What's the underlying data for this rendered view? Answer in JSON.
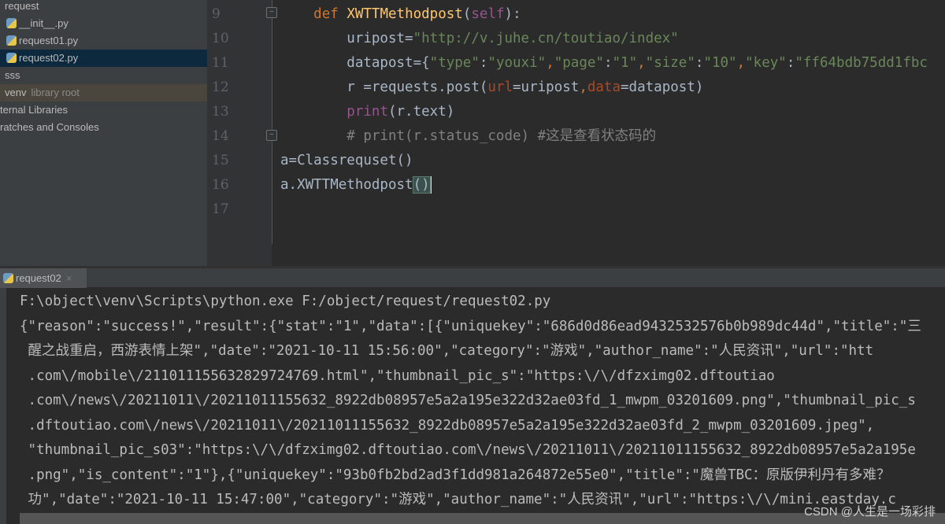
{
  "sidebar": {
    "items": [
      {
        "label": "request",
        "kind": "folder"
      },
      {
        "label": "__init__.py",
        "kind": "python-file"
      },
      {
        "label": "request01.py",
        "kind": "python-file"
      },
      {
        "label": "request02.py",
        "kind": "python-file",
        "selected": true
      },
      {
        "label": "sss",
        "kind": "folder"
      },
      {
        "label": "venv",
        "kind": "folder",
        "suffix": "library root"
      },
      {
        "label": "ternal Libraries",
        "kind": "node"
      },
      {
        "label": "ratches and Consoles",
        "kind": "node"
      }
    ]
  },
  "editor": {
    "line_numbers": [
      "9",
      "10",
      "11",
      "12",
      "13",
      "14",
      "15",
      "16",
      "17"
    ],
    "lines": [
      [
        {
          "t": "    ",
          "c": "pl"
        },
        {
          "t": "def ",
          "c": "kw"
        },
        {
          "t": "XWTTMethodpost",
          "c": "fn"
        },
        {
          "t": "(",
          "c": "pl"
        },
        {
          "t": "self",
          "c": "sf"
        },
        {
          "t": "):",
          "c": "pl"
        }
      ],
      [
        {
          "t": "        uripost=",
          "c": "pl"
        },
        {
          "t": "\"http://v.juhe.cn/toutiao/index\"",
          "c": "st"
        }
      ],
      [
        {
          "t": "        datapost={",
          "c": "pl"
        },
        {
          "t": "\"type\"",
          "c": "st"
        },
        {
          "t": ":",
          "c": "pl"
        },
        {
          "t": "\"youxi\"",
          "c": "st"
        },
        {
          "t": ",",
          "c": "kw"
        },
        {
          "t": "\"page\"",
          "c": "st"
        },
        {
          "t": ":",
          "c": "pl"
        },
        {
          "t": "\"1\"",
          "c": "st"
        },
        {
          "t": ",",
          "c": "kw"
        },
        {
          "t": "\"size\"",
          "c": "st"
        },
        {
          "t": ":",
          "c": "pl"
        },
        {
          "t": "\"10\"",
          "c": "st"
        },
        {
          "t": ",",
          "c": "kw"
        },
        {
          "t": "\"key\"",
          "c": "st"
        },
        {
          "t": ":",
          "c": "pl"
        },
        {
          "t": "\"ff64bdb75dd1fbc",
          "c": "st"
        }
      ],
      [
        {
          "t": "        r =requests.post(",
          "c": "pl"
        },
        {
          "t": "url",
          "c": "pr"
        },
        {
          "t": "=uripost",
          "c": "pl"
        },
        {
          "t": ",",
          "c": "kw"
        },
        {
          "t": "data",
          "c": "pr"
        },
        {
          "t": "=datapost)",
          "c": "pl"
        }
      ],
      [
        {
          "t": "        ",
          "c": "pl"
        },
        {
          "t": "print",
          "c": "sf"
        },
        {
          "t": "(r.text)",
          "c": "pl"
        }
      ],
      [
        {
          "t": "        # print(r.status_code) #这是查看状态码的",
          "c": "cm"
        }
      ],
      [
        {
          "t": "a=Classrequset()",
          "c": "pl"
        }
      ],
      [
        {
          "t": "a.XWTTMethodpost",
          "c": "pl"
        },
        {
          "t": "()",
          "c": "hl"
        }
      ],
      []
    ]
  },
  "run_panel": {
    "tab_label": "request02",
    "output": [
      "F:\\object\\venv\\Scripts\\python.exe F:/object/request/request02.py",
      "{\"reason\":\"success!\",\"result\":{\"stat\":\"1\",\"data\":[{\"uniquekey\":\"686d0d86ead9432532576b0b989dc44d\",\"title\":\"三",
      " 醒之战重启，西游表情上架\",\"date\":\"2021-10-11 15:56:00\",\"category\":\"游戏\",\"author_name\":\"人民资讯\",\"url\":\"htt",
      " .com\\/mobile\\/211011155632829724769.html\",\"thumbnail_pic_s\":\"https:\\/\\/dfzximg02.dftoutiao",
      " .com\\/news\\/20211011\\/20211011155632_8922db08957e5a2a195e322d32ae03fd_1_mwpm_03201609.png\",\"thumbnail_pic_s",
      " .dftoutiao.com\\/news\\/20211011\\/20211011155632_8922db08957e5a2a195e322d32ae03fd_2_mwpm_03201609.jpeg\",",
      " \"thumbnail_pic_s03\":\"https:\\/\\/dfzximg02.dftoutiao.com\\/news\\/20211011\\/20211011155632_8922db08957e5a2a195e",
      " .png\",\"is_content\":\"1\"},{\"uniquekey\":\"93b0fb2bd2ad3f1dd981a264872e55e0\",\"title\":\"魔兽TBC：原版伊利丹有多难？",
      " 功\",\"date\":\"2021-10-11 15:47:00\",\"category\":\"游戏\",\"author_name\":\"人民资讯\",\"url\":\"https:\\/\\/mini.eastday.c"
    ]
  },
  "watermark": "CSDN @人生是一场彩排"
}
